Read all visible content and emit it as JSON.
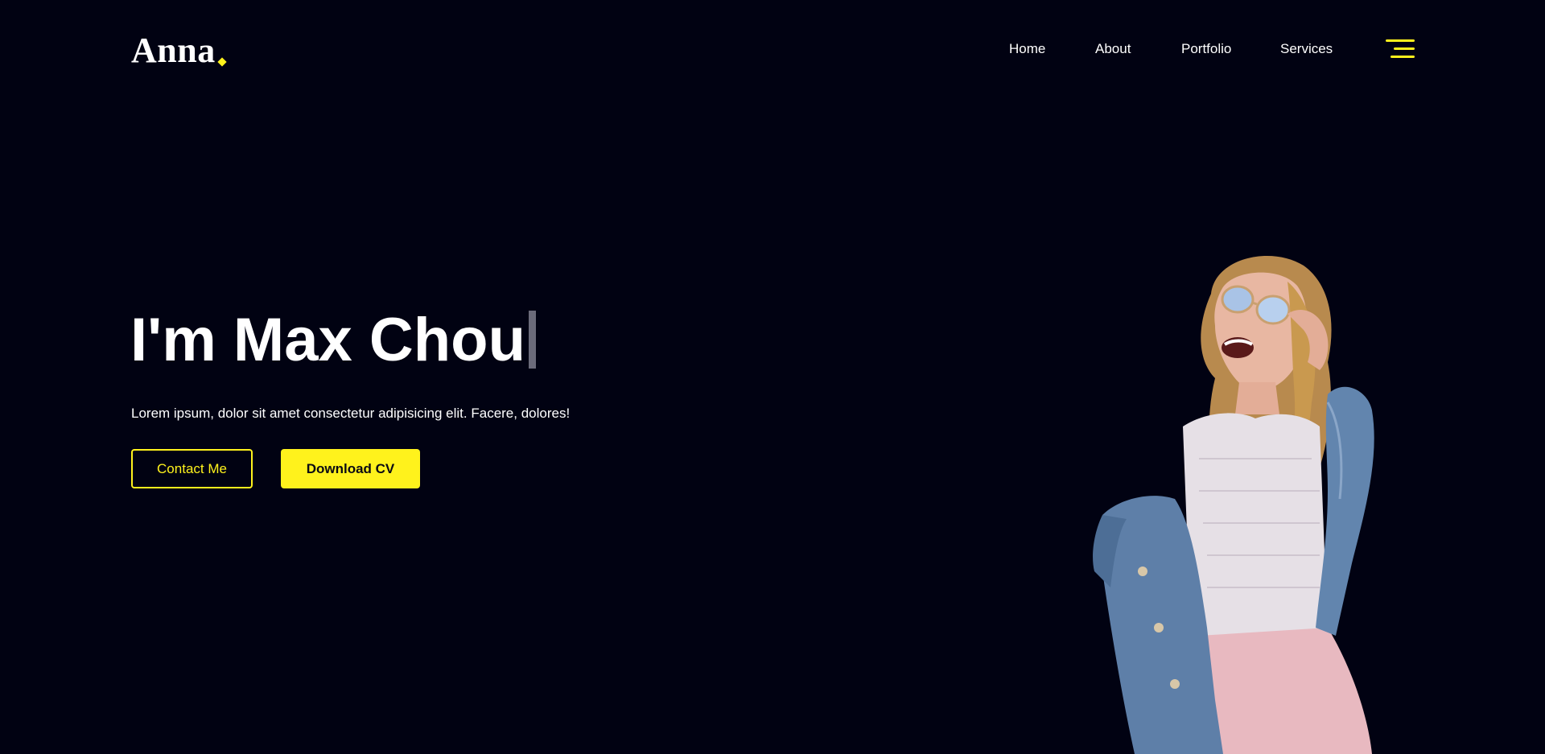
{
  "header": {
    "logo_text": "Anna",
    "nav": {
      "home": "Home",
      "about": "About",
      "portfolio": "Portfolio",
      "services": "Services"
    },
    "menu_icon": "hamburger-menu-icon"
  },
  "hero": {
    "title": "I'm Max Chou",
    "description": "Lorem ipsum, dolor sit amet consectetur adipisicing elit. Facere, dolores!",
    "contact_button": "Contact Me",
    "download_button": "Download CV"
  },
  "colors": {
    "background": "#010212",
    "accent": "#fff21c",
    "text": "#ffffff"
  }
}
